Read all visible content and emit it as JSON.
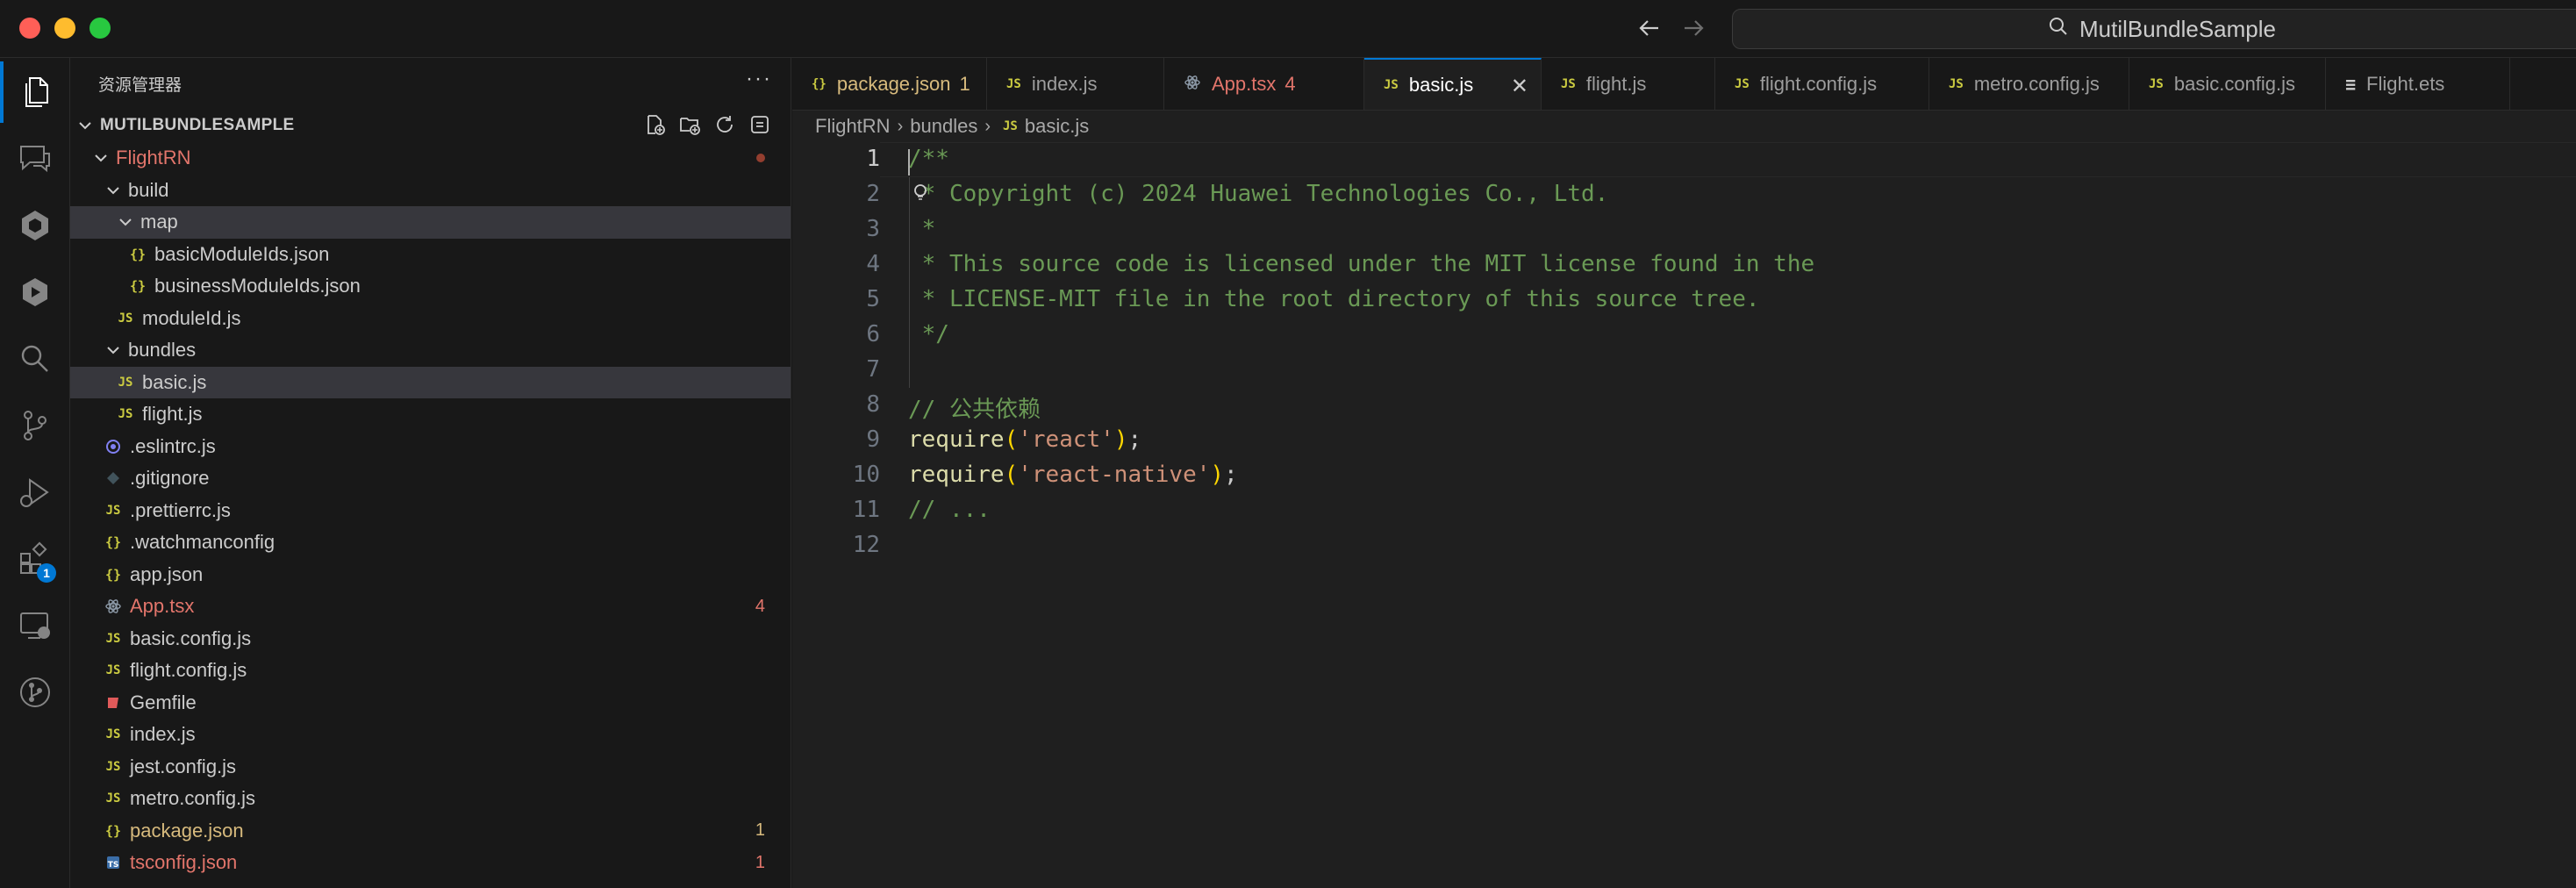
{
  "window": {
    "search_text": "MutilBundleSample"
  },
  "activity_bar": {
    "items": [
      "explorer",
      "chat",
      "codegenie",
      "extension-pack",
      "search",
      "source-control",
      "run-debug",
      "extensions",
      "remote-explorer",
      "git-graph"
    ],
    "extensions_badge": "1"
  },
  "sidebar": {
    "header": "资源管理器",
    "more": "···",
    "section_title": "MUTILBUNDLESAMPLE",
    "tree": [
      {
        "label": "FlightRN",
        "depth": 1,
        "kind": "folder-open",
        "status": "modified-dot"
      },
      {
        "label": "build",
        "depth": 2,
        "kind": "folder-open"
      },
      {
        "label": "map",
        "depth": 3,
        "kind": "folder-open",
        "selected": true
      },
      {
        "label": "basicModuleIds.json",
        "depth": 4,
        "kind": "json"
      },
      {
        "label": "businessModuleIds.json",
        "depth": 4,
        "kind": "json"
      },
      {
        "label": "moduleId.js",
        "depth": 3,
        "kind": "js"
      },
      {
        "label": "bundles",
        "depth": 2,
        "kind": "folder-open"
      },
      {
        "label": "basic.js",
        "depth": 3,
        "kind": "js",
        "selected": true
      },
      {
        "label": "flight.js",
        "depth": 3,
        "kind": "js"
      },
      {
        "label": ".eslintrc.js",
        "depth": 2,
        "kind": "eslint"
      },
      {
        "label": ".gitignore",
        "depth": 2,
        "kind": "git"
      },
      {
        "label": ".prettierrc.js",
        "depth": 2,
        "kind": "js"
      },
      {
        "label": ".watchmanconfig",
        "depth": 2,
        "kind": "json"
      },
      {
        "label": "app.json",
        "depth": 2,
        "kind": "json"
      },
      {
        "label": "App.tsx",
        "depth": 2,
        "kind": "react",
        "badge": "4",
        "status": "error"
      },
      {
        "label": "basic.config.js",
        "depth": 2,
        "kind": "js"
      },
      {
        "label": "flight.config.js",
        "depth": 2,
        "kind": "js"
      },
      {
        "label": "Gemfile",
        "depth": 2,
        "kind": "ruby"
      },
      {
        "label": "index.js",
        "depth": 2,
        "kind": "js"
      },
      {
        "label": "jest.config.js",
        "depth": 2,
        "kind": "js"
      },
      {
        "label": "metro.config.js",
        "depth": 2,
        "kind": "js"
      },
      {
        "label": "package.json",
        "depth": 2,
        "kind": "json",
        "badge": "1",
        "status": "warning"
      },
      {
        "label": "tsconfig.json",
        "depth": 2,
        "kind": "ts",
        "badge": "1",
        "status": "error"
      }
    ]
  },
  "tabs": [
    {
      "label": "package.json",
      "badge": "1",
      "kind": "json",
      "status": "warning"
    },
    {
      "label": "index.js",
      "kind": "js"
    },
    {
      "label": "App.tsx",
      "badge": "4",
      "kind": "react",
      "status": "error"
    },
    {
      "label": "basic.js",
      "kind": "js",
      "active": true
    },
    {
      "label": "flight.js",
      "kind": "js"
    },
    {
      "label": "flight.config.js",
      "kind": "js"
    },
    {
      "label": "metro.config.js",
      "kind": "js"
    },
    {
      "label": "basic.config.js",
      "kind": "js"
    },
    {
      "label": "Flight.ets",
      "kind": "ets"
    }
  ],
  "breadcrumb": [
    "FlightRN",
    "bundles",
    "basic.js"
  ],
  "editor": {
    "current_line": 1,
    "lines": [
      "/**",
      " * Copyright (c) 2024 Huawei Technologies Co., Ltd.",
      " *",
      " * This source code is licensed under the MIT license found in the",
      " * LICENSE-MIT file in the root directory of this source tree.",
      " */",
      "",
      "// 公共依赖",
      "require('react');",
      "require('react-native');",
      "// ...",
      ""
    ]
  },
  "colors": {
    "accent": "#0078d4",
    "comment": "#6a9955",
    "string": "#ce9178",
    "function": "#dcdcaa",
    "error": "#e2756b",
    "warning": "#d7ba7d"
  }
}
